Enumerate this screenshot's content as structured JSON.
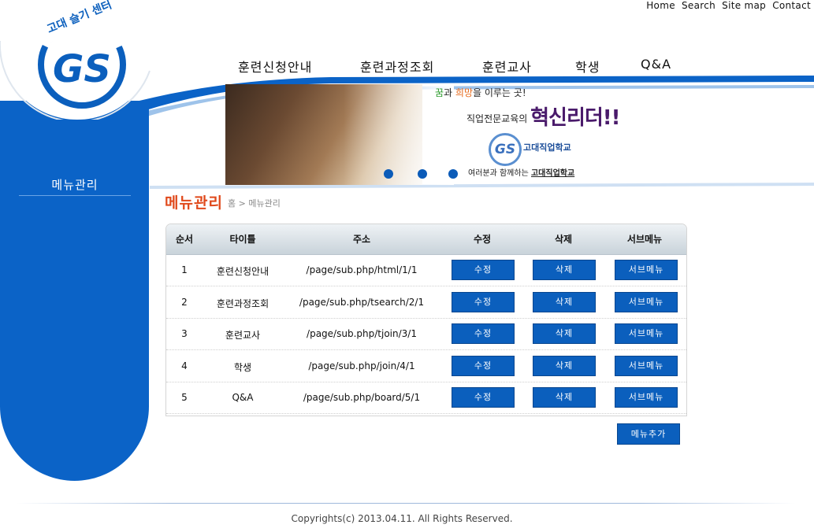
{
  "util_links": [
    "Home",
    "Search",
    "Site map",
    "Contact"
  ],
  "nav": [
    "훈련신청안내",
    "훈련과정조회",
    "훈련교사",
    "학생",
    "Q&A"
  ],
  "logo": {
    "arc_text": "고대 슬기 센터",
    "mark": "GS"
  },
  "sidebar": {
    "title": "메뉴관리"
  },
  "banner": {
    "line1_a": "꿈",
    "line1_b": "과 ",
    "line1_c": "희망",
    "line1_d": "을 이루는 곳!",
    "line2": "직업전문교육의",
    "line2_big": "혁신리더!!",
    "logo_mark": "GS",
    "logo_text": "고대직업학교",
    "line3": "여러분과 함께하는",
    "line3_u": "고대직업학교"
  },
  "page": {
    "title": "메뉴관리",
    "breadcrumb": "홈 > 메뉴관리"
  },
  "table": {
    "headers": [
      "순서",
      "타이틀",
      "주소",
      "수정",
      "삭제",
      "서브메뉴"
    ],
    "rows": [
      {
        "no": "1",
        "title": "훈련신청안내",
        "url": "/page/sub.php/html/1/1"
      },
      {
        "no": "2",
        "title": "훈련과정조회",
        "url": "/page/sub.php/tsearch/2/1"
      },
      {
        "no": "3",
        "title": "훈련교사",
        "url": "/page/sub.php/tjoin/3/1"
      },
      {
        "no": "4",
        "title": "학생",
        "url": "/page/sub.php/join/4/1"
      },
      {
        "no": "5",
        "title": "Q&A",
        "url": "/page/sub.php/board/5/1"
      }
    ],
    "edit_label": "수정",
    "delete_label": "삭제",
    "submenu_label": "서브메뉴"
  },
  "add_button": "메뉴추가",
  "footer": {
    "copyright": "Copyrights(c) 2013.04.11. All Rights Reserved."
  },
  "colors": {
    "primary_blue": "#0b63c7",
    "title_orange": "#e0491b",
    "banner_purple": "#4a1b6b"
  }
}
